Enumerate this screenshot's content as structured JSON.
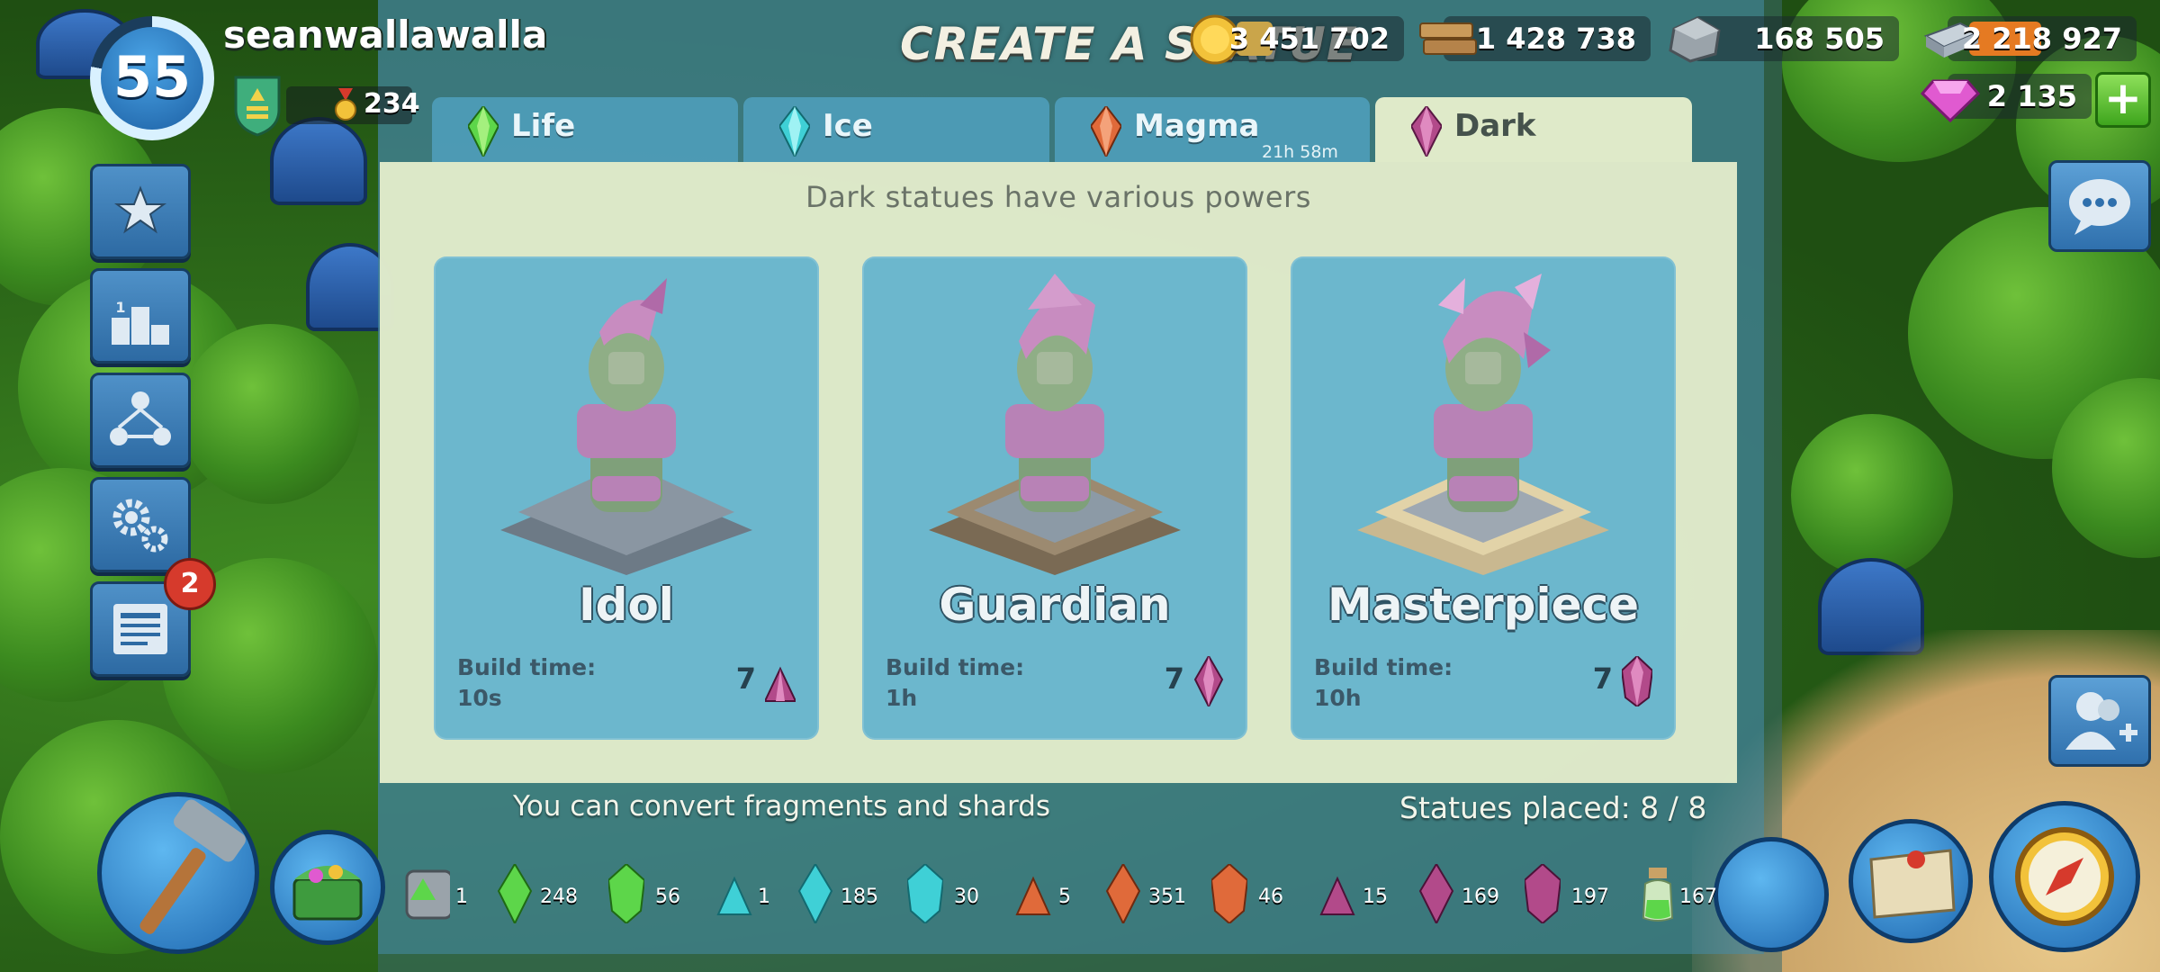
{
  "player": {
    "level": "55",
    "name": "seanwallawalla",
    "medals": "234"
  },
  "title": "CREATE A STATUE",
  "resources": {
    "gold": "3 451 702",
    "wood": "1 428 738",
    "stone": "168 505",
    "iron": "2 218 927",
    "diamonds": "2 135",
    "add_label": "+"
  },
  "tabs": [
    {
      "label": "Life",
      "color": "#5dd64a"
    },
    {
      "label": "Ice",
      "color": "#3fd0d6"
    },
    {
      "label": "Magma",
      "color": "#e06a3a",
      "timer": "21h 58m"
    },
    {
      "label": "Dark",
      "color": "#b24a8a",
      "active": true
    }
  ],
  "panel": {
    "subtitle": "Dark statues have various powers",
    "convert_hint": "You can convert fragments and shards",
    "statues_placed": "Statues placed: 8 / 8"
  },
  "statues": [
    {
      "name": "Idol",
      "build_label": "Build time:",
      "build_time": "10s",
      "cost": "7",
      "gem": "fragment"
    },
    {
      "name": "Guardian",
      "build_label": "Build time:",
      "build_time": "1h",
      "cost": "7",
      "gem": "shard"
    },
    {
      "name": "Masterpiece",
      "build_label": "Build time:",
      "build_time": "10h",
      "cost": "7",
      "gem": "crystal"
    }
  ],
  "inventory": {
    "upgrade_count": "1",
    "life_fragment": "248",
    "life_shard": "56",
    "life_crystal": "",
    "ice_fragment": "1",
    "ice_shard": "185",
    "ice_crystal": "30",
    "magma_fragment": "5",
    "magma_shard": "351",
    "magma_crystal": "46",
    "dark_fragment": "15",
    "dark_shard": "169",
    "dark_crystal": "197",
    "powder": "167"
  },
  "side_menu": {
    "news_badge": "2"
  },
  "colors": {
    "life": "#5dd64a",
    "ice": "#3fd0d6",
    "magma": "#e06a3a",
    "dark": "#b24a8a",
    "panel": "#e8f0ce",
    "card": "#58aece"
  }
}
